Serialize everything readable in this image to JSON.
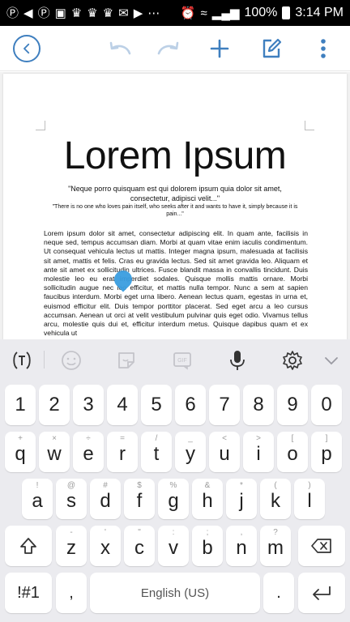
{
  "status_bar": {
    "battery_text": "100%",
    "time": "3:14 PM"
  },
  "toolbar": {
    "back_icon": "back-circle-icon",
    "undo_icon": "undo-icon",
    "redo_icon": "redo-icon",
    "add_icon": "plus-icon",
    "edit_icon": "edit-icon",
    "more_icon": "more-vertical-icon"
  },
  "document": {
    "title": "Lorem Ipsum",
    "quote": "\"Neque porro quisquam est qui dolorem ipsum quia dolor sit amet, consectetur, adipisci velit...\"",
    "quote_translation": "\"There is no one who loves pain itself, who seeks after it and wants to have it, simply because it is pain...\"",
    "body": "Lorem ipsum dolor sit amet, consectetur adipiscing elit. In quam ante, facilisis in neque sed, tempus accumsan diam. Morbi at quam vitae enim iaculis condimentum. Ut consequat vehicula lectus ut mattis. Integer magna ipsum, malesuada at facilisis sit amet, mattis et felis. Cras eu gravida lectus. Sed sit amet gravida leo. Aliquam et ante sit amet ex sollicitudin ultrices. Fusce blandit massa in convallis tincidunt. Duis molestie leo eu erat imperdiet sodales. Quisque mollis mattis ornare. Morbi sollicitudin augue nec leo efficitur, et mattis nulla tempor. Nunc a sem at sapien faucibus interdum. Morbi eget urna libero. Aenean lectus quam, egestas in urna et, euismod efficitur elit. Duis tempor porttitor placerat. Sed eget arcu a leo cursus accumsan. Aenean ut orci at velit vestibulum pulvinar quis eget odio. Vivamus tellus arcu, molestie quis dui et, efficitur interdum metus. Quisque dapibus quam et ex vehicula ut"
  },
  "keyboard": {
    "number_row": [
      "1",
      "2",
      "3",
      "4",
      "5",
      "6",
      "7",
      "8",
      "9",
      "0"
    ],
    "row1": [
      {
        "main": "q",
        "sub": "+"
      },
      {
        "main": "w",
        "sub": "×"
      },
      {
        "main": "e",
        "sub": "÷"
      },
      {
        "main": "r",
        "sub": "="
      },
      {
        "main": "t",
        "sub": "/"
      },
      {
        "main": "y",
        "sub": "_"
      },
      {
        "main": "u",
        "sub": "<"
      },
      {
        "main": "i",
        "sub": ">"
      },
      {
        "main": "o",
        "sub": "["
      },
      {
        "main": "p",
        "sub": "]"
      }
    ],
    "row2": [
      {
        "main": "a",
        "sub": "!"
      },
      {
        "main": "s",
        "sub": "@"
      },
      {
        "main": "d",
        "sub": "#"
      },
      {
        "main": "f",
        "sub": "$"
      },
      {
        "main": "g",
        "sub": "%"
      },
      {
        "main": "h",
        "sub": "&"
      },
      {
        "main": "j",
        "sub": "*"
      },
      {
        "main": "k",
        "sub": "("
      },
      {
        "main": "l",
        "sub": ")"
      }
    ],
    "row3": [
      {
        "main": "z",
        "sub": "-"
      },
      {
        "main": "x",
        "sub": "'"
      },
      {
        "main": "c",
        "sub": "\""
      },
      {
        "main": "v",
        "sub": ":"
      },
      {
        "main": "b",
        "sub": ";"
      },
      {
        "main": "n",
        "sub": ","
      },
      {
        "main": "m",
        "sub": "?"
      }
    ],
    "sym_label": "!#1",
    "comma_label": ",",
    "space_label": "English (US)",
    "period_label": "."
  }
}
